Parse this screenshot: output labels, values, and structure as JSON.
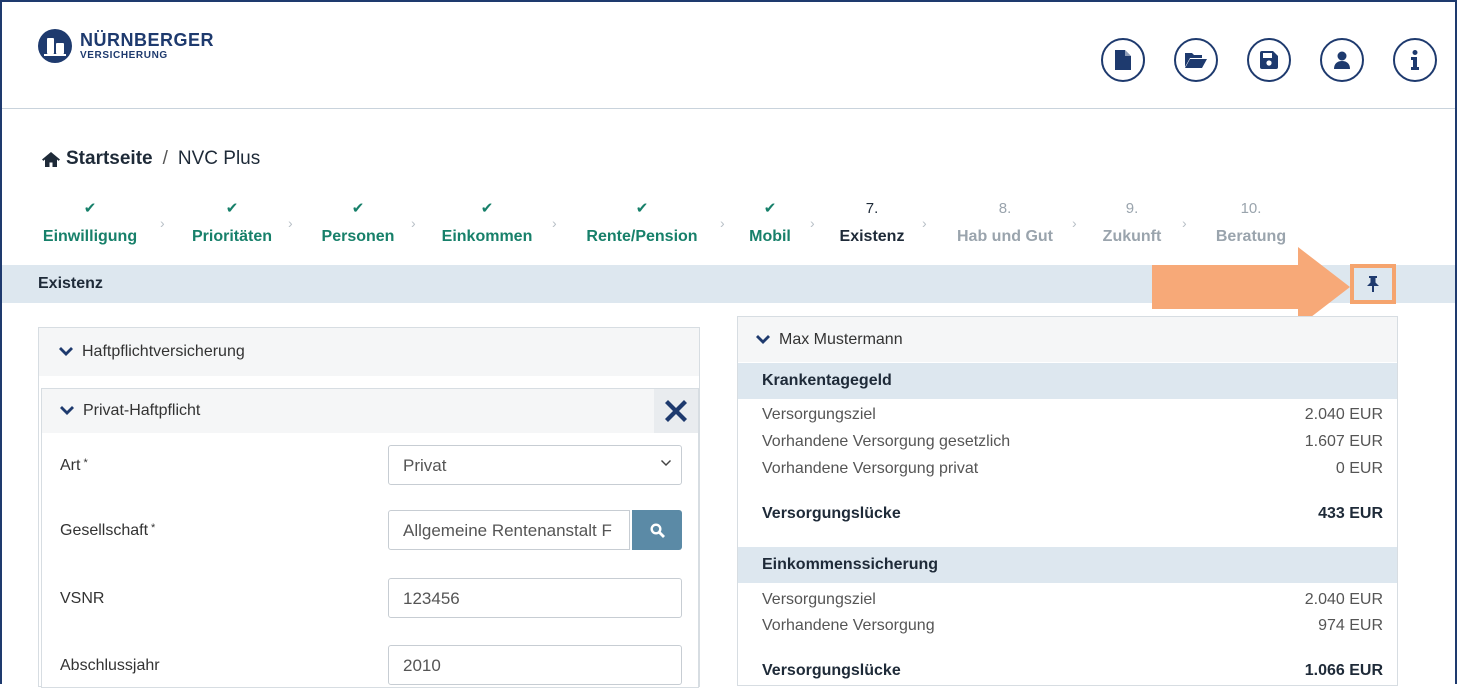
{
  "header": {
    "brand_line1": "NÜRNBERGER",
    "brand_line2": "VERSICHERUNG",
    "icons": [
      "file-icon",
      "folder-open-icon",
      "save-icon",
      "user-icon",
      "info-icon"
    ]
  },
  "breadcrumb": {
    "home": "Startseite",
    "separator": "/",
    "current": "NVC Plus"
  },
  "steps": [
    {
      "mark": "✔",
      "label": "Einwilligung",
      "state": "done"
    },
    {
      "mark": "✔",
      "label": "Prioritäten",
      "state": "done"
    },
    {
      "mark": "✔",
      "label": "Personen",
      "state": "done"
    },
    {
      "mark": "✔",
      "label": "Einkommen",
      "state": "done"
    },
    {
      "mark": "✔",
      "label": "Rente/Pension",
      "state": "done"
    },
    {
      "mark": "✔",
      "label": "Mobil",
      "state": "done"
    },
    {
      "mark": "7.",
      "label": "Existenz",
      "state": "active"
    },
    {
      "mark": "8.",
      "label": "Hab und Gut",
      "state": "todo"
    },
    {
      "mark": "9.",
      "label": "Zukunft",
      "state": "todo"
    },
    {
      "mark": "10.",
      "label": "Beratung",
      "state": "todo"
    }
  ],
  "section": {
    "title": "Existenz"
  },
  "left": {
    "panel_title": "Haftpflichtversicherung",
    "sub_title": "Privat-Haftpflicht",
    "fields": {
      "art": {
        "label": "Art",
        "required": "*",
        "value": "Privat"
      },
      "gesellschaft": {
        "label": "Gesellschaft",
        "required": "*",
        "value": "Allgemeine Rentenanstalt F"
      },
      "vsnr": {
        "label": "VSNR",
        "value": "123456"
      },
      "abschlussjahr": {
        "label": "Abschlussjahr",
        "value": "2010"
      }
    }
  },
  "right": {
    "person": "Max Mustermann",
    "krankentagegeld": {
      "title": "Krankentagegeld",
      "rows": [
        {
          "label": "Versorgungsziel",
          "value": "2.040 EUR"
        },
        {
          "label": "Vorhandene Versorgung gesetzlich",
          "value": "1.607 EUR"
        },
        {
          "label": "Vorhandene Versorgung privat",
          "value": "0 EUR"
        }
      ],
      "gap_label": "Versorgungslücke",
      "gap_value": "433 EUR"
    },
    "einkommenssicherung": {
      "title": "Einkommenssicherung",
      "rows": [
        {
          "label": "Versorgungsziel",
          "value": "2.040 EUR"
        },
        {
          "label": "Vorhandene Versorgung",
          "value": "974 EUR"
        }
      ],
      "gap_label": "Versorgungslücke",
      "gap_value": "1.066 EUR"
    }
  },
  "colors": {
    "brand": "#1e3a6e",
    "done": "#17806a",
    "highlight": "#f5a46e",
    "band": "#dde7ef",
    "search_button": "#5b8aa6"
  }
}
